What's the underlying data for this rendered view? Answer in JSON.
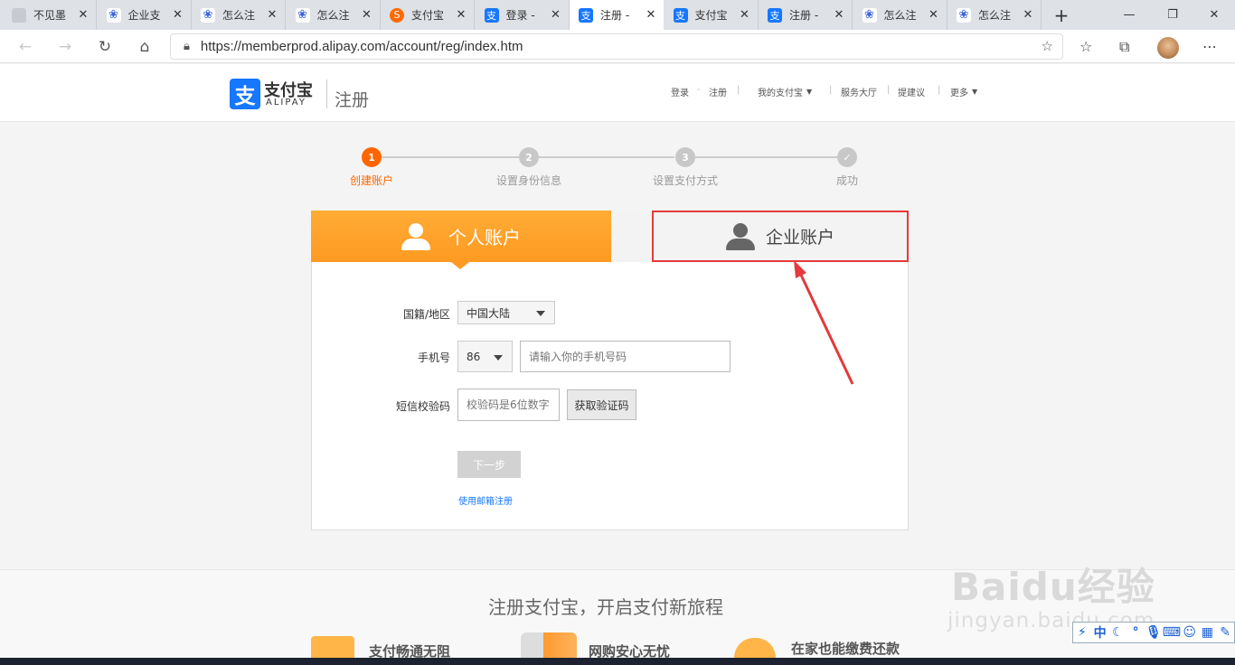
{
  "browser": {
    "tabs": [
      {
        "label": "不见墨",
        "icon": "gray"
      },
      {
        "label": "企业支",
        "icon": "paw"
      },
      {
        "label": "怎么注",
        "icon": "paw"
      },
      {
        "label": "怎么注",
        "icon": "paw"
      },
      {
        "label": "支付宝",
        "icon": "sogou"
      },
      {
        "label": "登录 - ",
        "icon": "alipay"
      },
      {
        "label": "注册 - ",
        "icon": "alipay",
        "active": true
      },
      {
        "label": "支付宝",
        "icon": "alipay"
      },
      {
        "label": "注册 - ",
        "icon": "alipay"
      },
      {
        "label": "怎么注",
        "icon": "paw"
      },
      {
        "label": "怎么注",
        "icon": "paw"
      }
    ],
    "url": "https://memberprod.alipay.com/account/reg/index.htm",
    "new_tab_label": "+"
  },
  "header": {
    "logo_icon_char": "支",
    "logo_cn": "支付宝",
    "logo_en": "ALIPAY",
    "page_name": "注册",
    "nav": {
      "login": "登录",
      "register": "注册",
      "my_alipay": "我的支付宝",
      "service_hall": "服务大厅",
      "suggest": "提建议",
      "more": "更多"
    }
  },
  "steps": [
    {
      "num": "1",
      "label": "创建账户",
      "active": true
    },
    {
      "num": "2",
      "label": "设置身份信息",
      "active": false
    },
    {
      "num": "3",
      "label": "设置支付方式",
      "active": false
    },
    {
      "num": "✓",
      "label": "成功",
      "active": false
    }
  ],
  "account_tabs": {
    "personal": "个人账户",
    "enterprise": "企业账户"
  },
  "form": {
    "region_label": "国籍/地区",
    "region_value": "中国大陆",
    "phone_label": "手机号",
    "country_code": "86",
    "phone_placeholder": "请输入你的手机号码",
    "sms_label": "短信校验码",
    "sms_placeholder": "校验码是6位数字",
    "get_code_button": "获取验证码",
    "next_button": "下一步",
    "email_register_link": "使用邮箱注册"
  },
  "footer": {
    "title": "注册支付宝，开启支付新旅程",
    "features": [
      "支付畅通无阻",
      "网购安心无忧",
      "在家也能缴费还款"
    ]
  },
  "watermark": {
    "brand": "Baidu经验",
    "domain": "jingyan.baidu.com"
  },
  "colors": {
    "accent_orange": "#ff6600",
    "alipay_blue": "#1677ff",
    "highlight_red": "#e43a3a"
  }
}
